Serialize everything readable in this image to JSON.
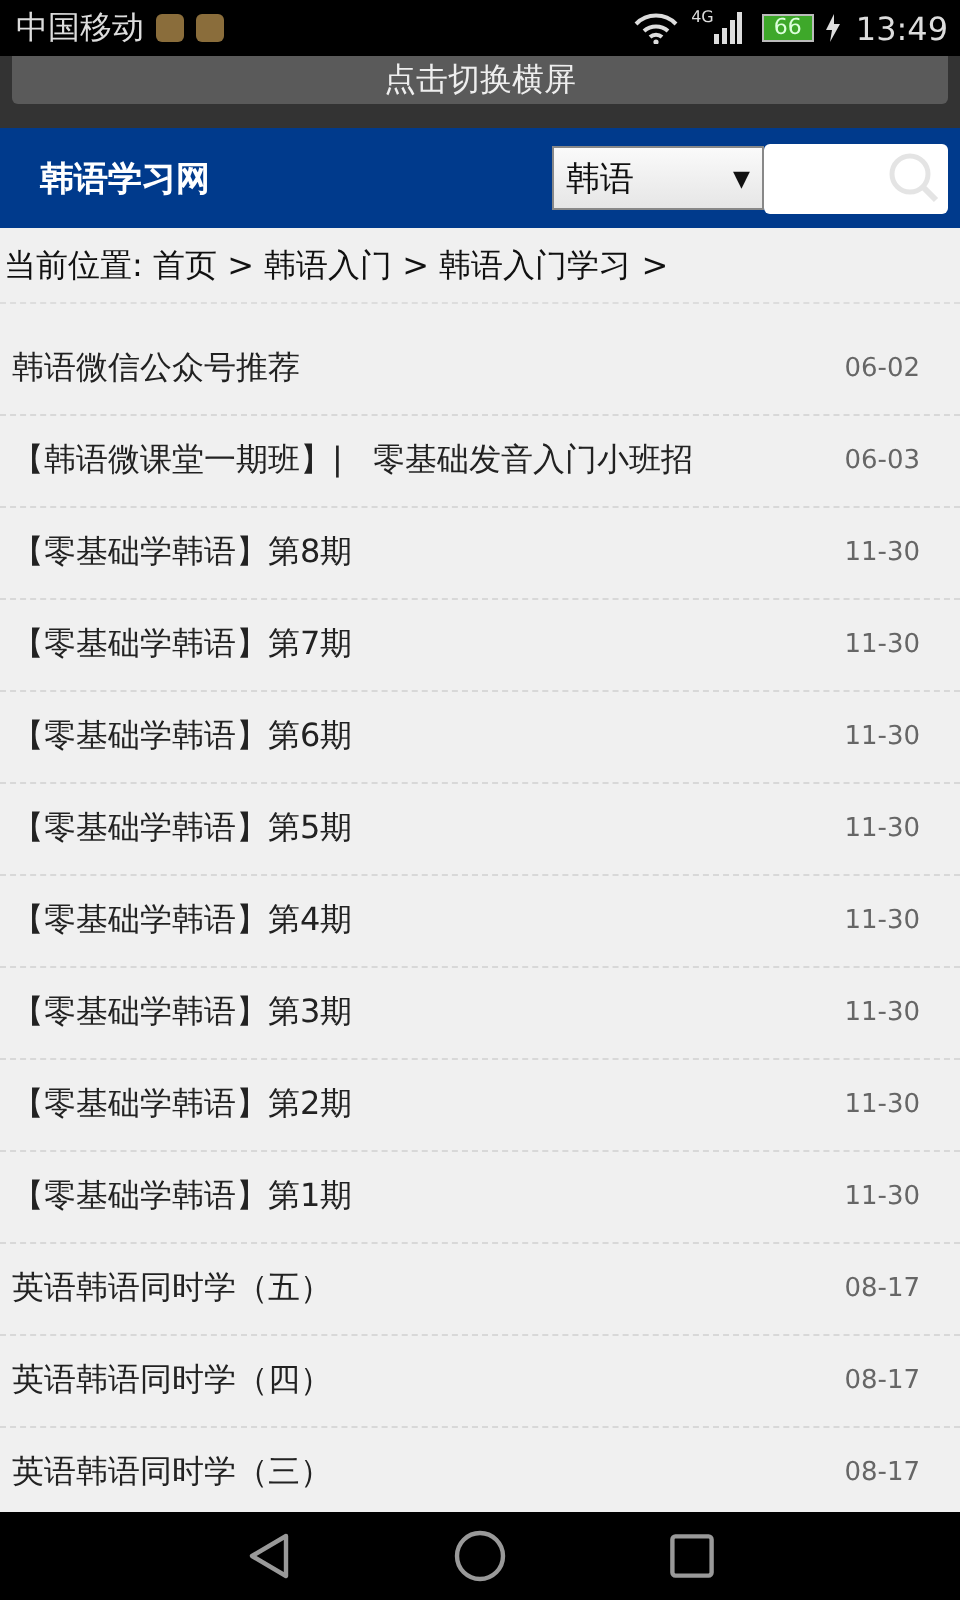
{
  "status_bar": {
    "carrier": "中国移动",
    "network": "4G",
    "battery": "66",
    "time": "13:49"
  },
  "banner": {
    "label": "点击切换横屏"
  },
  "header": {
    "site_title": "韩语学习网",
    "language_select": "韩语",
    "select_arrow": "▼"
  },
  "breadcrumb": "当前位置: 首页 > 韩语入门 > 韩语入门学习 >",
  "articles": [
    {
      "title": "韩语微信公众号推荐",
      "date": "06-02"
    },
    {
      "title": "【韩语微课堂一期班】|   零基础发音入门小班招",
      "date": "06-03"
    },
    {
      "title": "【零基础学韩语】第8期",
      "date": "11-30"
    },
    {
      "title": "【零基础学韩语】第7期",
      "date": "11-30"
    },
    {
      "title": "【零基础学韩语】第6期",
      "date": "11-30"
    },
    {
      "title": "【零基础学韩语】第5期",
      "date": "11-30"
    },
    {
      "title": "【零基础学韩语】第4期",
      "date": "11-30"
    },
    {
      "title": "【零基础学韩语】第3期",
      "date": "11-30"
    },
    {
      "title": "【零基础学韩语】第2期",
      "date": "11-30"
    },
    {
      "title": "【零基础学韩语】第1期",
      "date": "11-30"
    },
    {
      "title": "英语韩语同时学（五）",
      "date": "08-17"
    },
    {
      "title": "英语韩语同时学（四）",
      "date": "08-17"
    },
    {
      "title": "英语韩语同时学（三）",
      "date": "08-17"
    }
  ]
}
